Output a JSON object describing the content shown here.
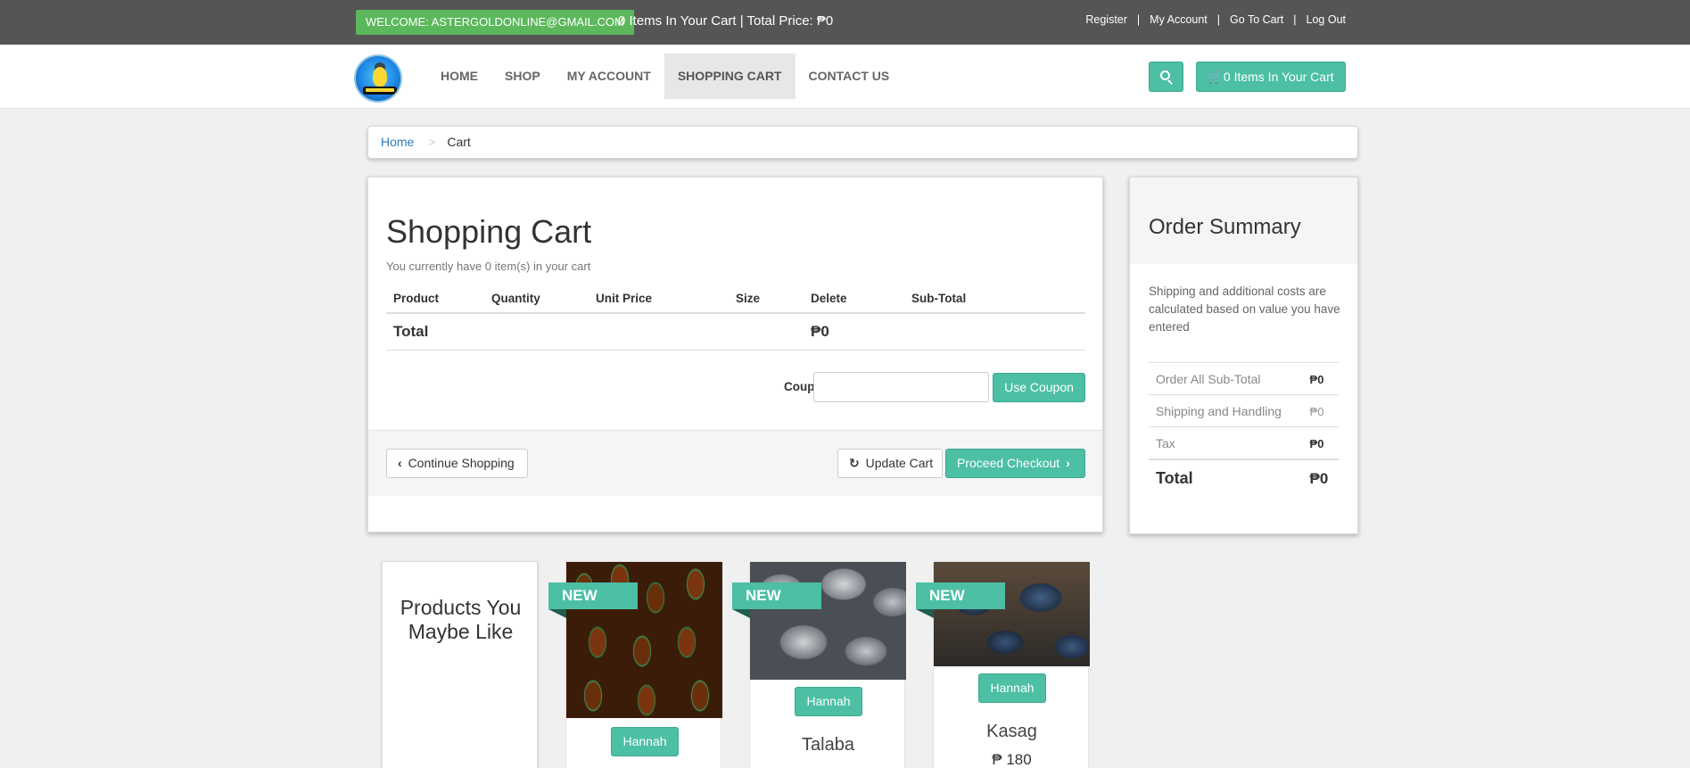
{
  "topbar": {
    "welcome": "WELCOME: ASTERGOLDONLINE@GMAIL.COM",
    "cart_summary": "0 Items In Your Cart | Total Price: ₱0",
    "links": [
      "Register",
      "My Account",
      "Go To Cart",
      "Log Out"
    ],
    "separator": "|"
  },
  "nav": {
    "items": [
      "HOME",
      "SHOP",
      "MY ACCOUNT",
      "SHOPPING CART",
      "CONTACT US"
    ],
    "active": "SHOPPING CART",
    "cart_button": "0 Items In Your Cart"
  },
  "breadcrumb": {
    "home": "Home",
    "separator": ">",
    "current": "Cart"
  },
  "cart": {
    "title": "Shopping Cart",
    "subtitle": "You currently have 0 item(s) in your cart",
    "columns": [
      "Product",
      "Quantity",
      "Unit Price",
      "Size",
      "Delete",
      "Sub-Total"
    ],
    "total_label": "Total",
    "total_value": "₱0",
    "coupon_label": "Coupon Code:",
    "coupon_value": "",
    "use_coupon": "Use Coupon",
    "continue_shopping": "Continue Shopping",
    "update_cart": "Update Cart",
    "proceed_checkout": "Proceed Checkout"
  },
  "summary": {
    "title": "Order Summary",
    "note": "Shipping and additional costs are calculated based on value you have entered",
    "rows": [
      {
        "label": "Order All Sub-Total",
        "value": "₱0"
      },
      {
        "label": "Shipping and Handling",
        "value": "₱0"
      },
      {
        "label": "Tax",
        "value": "₱0"
      }
    ],
    "total_label": "Total",
    "total_value": "₱0"
  },
  "products": {
    "heading": "Products You Maybe Like",
    "badge": "NEW",
    "items": [
      {
        "seller": "Hannah",
        "name": "",
        "price": ""
      },
      {
        "seller": "Hannah",
        "name": "Talaba",
        "price": ""
      },
      {
        "seller": "Hannah",
        "name": "Kasag",
        "price": "₱ 180"
      }
    ]
  },
  "colors": {
    "accent": "#4cbfa5",
    "welcome_green": "#5cb85c",
    "topbar": "#555555"
  }
}
